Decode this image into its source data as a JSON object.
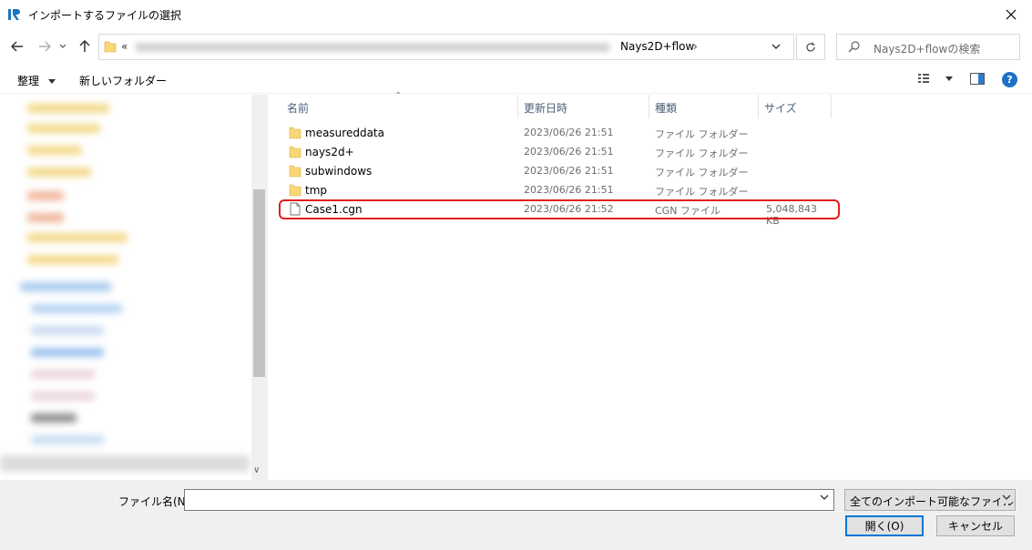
{
  "window": {
    "title": "インポートするファイルの選択"
  },
  "address": {
    "prev_label": "«",
    "current": "Nays2D+flow",
    "separator": "›"
  },
  "search": {
    "placeholder": "Nays2D+flowの検索"
  },
  "toolbar": {
    "organize": "整理",
    "new_folder": "新しいフォルダー",
    "help": "?"
  },
  "columns": {
    "name": "名前",
    "date": "更新日時",
    "type": "種類",
    "size": "サイズ"
  },
  "files": [
    {
      "name": "measureddata",
      "date": "2023/06/26 21:51",
      "type": "ファイル フォルダー",
      "size": "",
      "kind": "folder"
    },
    {
      "name": "nays2d+",
      "date": "2023/06/26 21:51",
      "type": "ファイル フォルダー",
      "size": "",
      "kind": "folder"
    },
    {
      "name": "subwindows",
      "date": "2023/06/26 21:51",
      "type": "ファイル フォルダー",
      "size": "",
      "kind": "folder"
    },
    {
      "name": "tmp",
      "date": "2023/06/26 21:51",
      "type": "ファイル フォルダー",
      "size": "",
      "kind": "folder"
    },
    {
      "name": "Case1.cgn",
      "date": "2023/06/26 21:52",
      "type": "CGN ファイル",
      "size": "5,048,843 KB",
      "kind": "file"
    }
  ],
  "bottom": {
    "filename_label": "ファイル名(N):",
    "filename_value": "",
    "filetype": "全てのインポート可能なファイル (*.a",
    "open_label": "開く(O)",
    "cancel_label": "キャンセル"
  },
  "colors": {
    "accent": "#0078d7",
    "highlight": "#e01e1e",
    "folder": "#f8d775"
  }
}
